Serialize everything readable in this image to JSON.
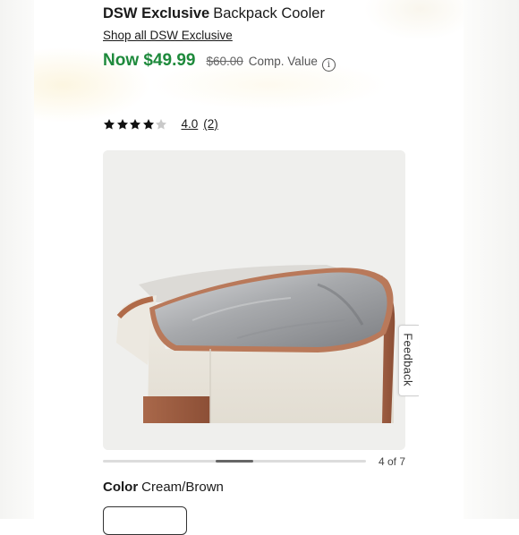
{
  "product": {
    "brand": "DSW Exclusive",
    "name": "Backpack Cooler",
    "shop_all_link": "Shop all DSW Exclusive"
  },
  "pricing": {
    "now": "Now $49.99",
    "was": "$60.00",
    "comp_label": "Comp. Value",
    "info_glyph": "i"
  },
  "rating": {
    "value": "4.0",
    "count": "(2)",
    "stars_filled": 4,
    "stars_total": 5
  },
  "gallery": {
    "counter": "4 of 7",
    "current_index": 4,
    "total": 7
  },
  "color": {
    "label": "Color",
    "value": "Cream/Brown"
  },
  "feedback": {
    "label": "Feedback"
  },
  "colors": {
    "price_green": "#1e8a3c",
    "star": "#111111",
    "star_empty": "#c9c9c9"
  },
  "icons": {
    "info": "info-icon",
    "star": "star-icon"
  }
}
